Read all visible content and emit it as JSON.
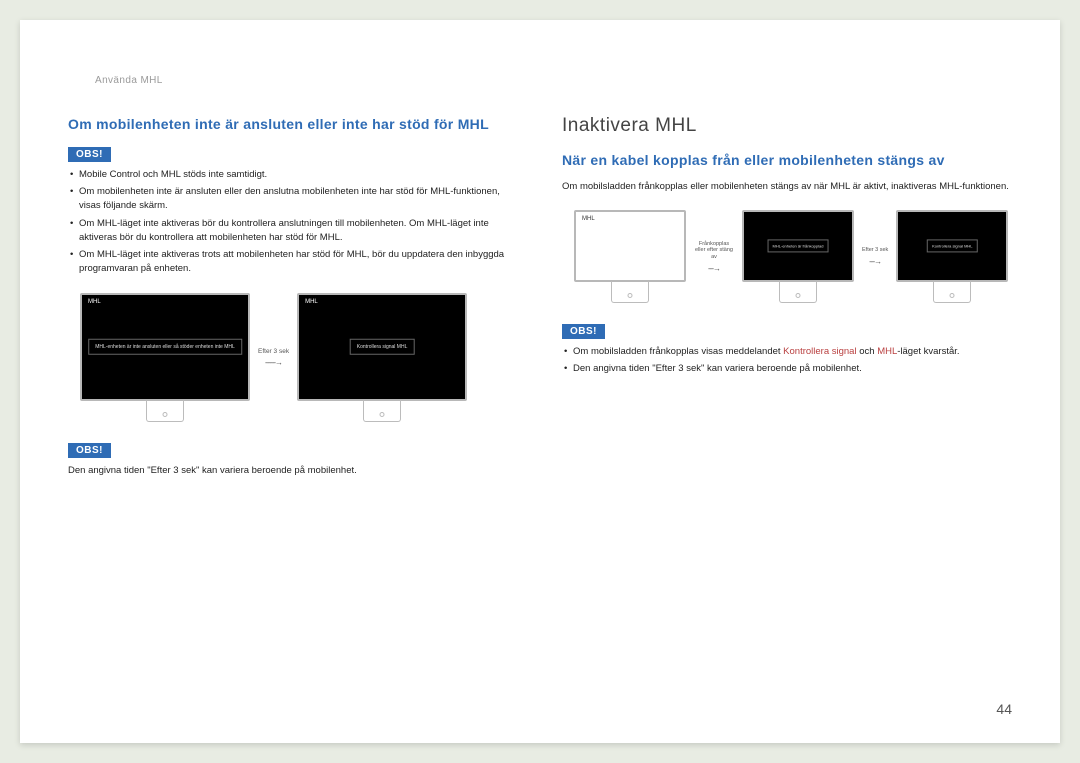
{
  "breadcrumb": "Använda MHL",
  "page_number": "44",
  "left": {
    "h2": "Om mobilenheten inte är ansluten eller inte har stöd för MHL",
    "obs1": "OBS!",
    "bullets1": [
      "Mobile Control och MHL stöds inte samtidigt.",
      "Om mobilenheten inte är ansluten eller den anslutna mobilenheten inte har stöd för MHL-funktionen, visas följande skärm.",
      "Om MHL-läget inte aktiveras bör du kontrollera anslutningen till mobilenheten. Om MHL-läget inte aktiveras bör du kontrollera att mobilenheten har stöd för MHL.",
      "Om MHL-läget inte aktiveras trots att mobilenheten har stöd för MHL, bör du uppdatera den inbyggda programvaran på enheten."
    ],
    "mon1_label": "MHL",
    "mon1_msg": "MHL-enheten är inte ansluten\neller så stöder enheten inte MHL",
    "arrow_label": "Efter 3 sek",
    "mon2_label": "MHL",
    "mon2_msg": "Kontrollera signal\nMHL",
    "obs2": "OBS!",
    "para2": "Den angivna tiden \"Efter 3 sek\" kan variera beroende på mobilenhet."
  },
  "right": {
    "h1": "Inaktivera MHL",
    "h2": "När en kabel kopplas från eller mobilenheten stängs av",
    "intro": "Om mobilsladden frånkopplas eller mobilenheten stängs av när MHL är aktivt, inaktiveras MHL-funktionen.",
    "mon1_label": "MHL",
    "arrow1_label": "Frånkopplas eller\nefter stäng av",
    "mon2_msg": "MHL-enheten är frånkopplad",
    "arrow2_label": "Efter 3 sek",
    "mon3_msg": "Kontrollera signal\nMHL",
    "obs": "OBS!",
    "bullet1_a": "Om mobilsladden frånkopplas visas meddelandet ",
    "bullet1_red1": "Kontrollera signal",
    "bullet1_b": " och ",
    "bullet1_red2": "MHL",
    "bullet1_c": "-läget kvarstår.",
    "bullet2": "Den angivna tiden \"Efter 3 sek\" kan variera beroende på mobilenhet."
  }
}
